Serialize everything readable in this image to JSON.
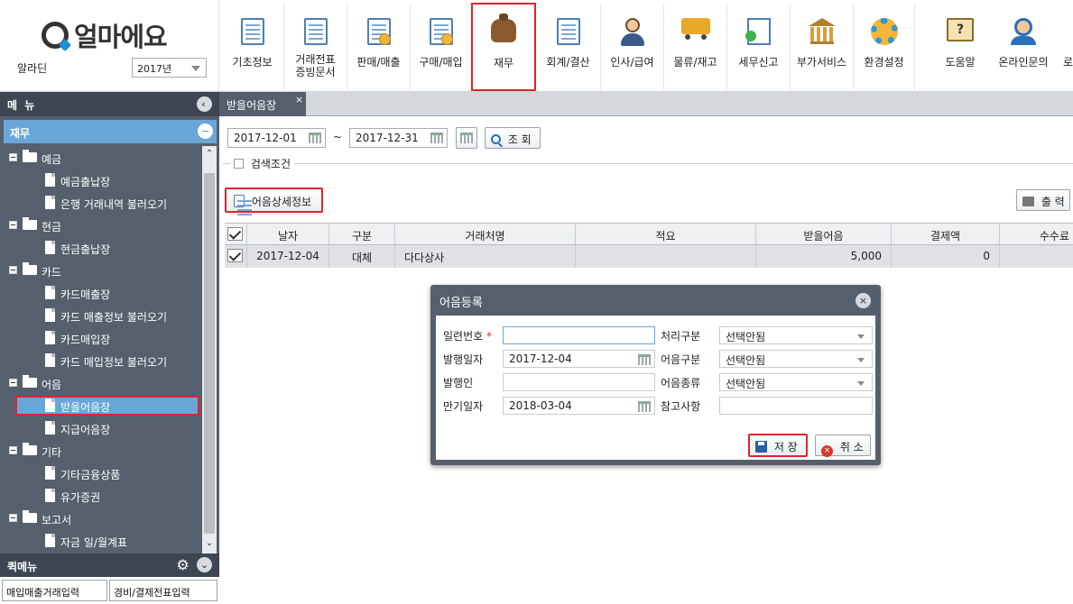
{
  "app": {
    "logo_text": "얼마에요",
    "company": "알라딘",
    "year": "2017년"
  },
  "top_menu": [
    {
      "id": "basic",
      "label": "기초정보"
    },
    {
      "id": "voucher",
      "label": "거래전표\n증빙문서"
    },
    {
      "id": "sales",
      "label": "판매/매출"
    },
    {
      "id": "purchase",
      "label": "구매/매입"
    },
    {
      "id": "finance",
      "label": "재무"
    },
    {
      "id": "accounting",
      "label": "회계/결산"
    },
    {
      "id": "hr",
      "label": "인사/급여"
    },
    {
      "id": "logistics",
      "label": "물류/재고"
    },
    {
      "id": "tax",
      "label": "세무신고"
    },
    {
      "id": "addon",
      "label": "부가서비스"
    },
    {
      "id": "settings",
      "label": "환경설정"
    },
    {
      "id": "help",
      "label": "도움말"
    },
    {
      "id": "online",
      "label": "온라인문의"
    },
    {
      "id": "logout",
      "label": "로"
    }
  ],
  "sidebar": {
    "menu_title": "메 뉴",
    "section_title": "재무",
    "tree": [
      {
        "type": "folder",
        "label": "예금"
      },
      {
        "type": "file",
        "label": "예금출납장"
      },
      {
        "type": "file",
        "label": "은행 거래내역 불러오기"
      },
      {
        "type": "folder",
        "label": "현금"
      },
      {
        "type": "file",
        "label": "현금출납장"
      },
      {
        "type": "folder",
        "label": "카드"
      },
      {
        "type": "file",
        "label": "카드매출장"
      },
      {
        "type": "file",
        "label": "카드 매출정보 불러오기"
      },
      {
        "type": "file",
        "label": "카드매입장"
      },
      {
        "type": "file",
        "label": "카드 매입정보 불러오기"
      },
      {
        "type": "folder",
        "label": "어음"
      },
      {
        "type": "file",
        "label": "받을어음장",
        "selected": true
      },
      {
        "type": "file",
        "label": "지급어음장"
      },
      {
        "type": "folder",
        "label": "기타"
      },
      {
        "type": "file",
        "label": "기타금융상품"
      },
      {
        "type": "file",
        "label": "유가증권"
      },
      {
        "type": "folder",
        "label": "보고서"
      },
      {
        "type": "file",
        "label": "자금 일/월계표"
      }
    ],
    "quick_title": "퀵메뉴",
    "quick_items": [
      "매입매출거래입력",
      "경비/결제전표입력"
    ]
  },
  "main": {
    "tab_label": "받을어음장",
    "tab_close": "×",
    "date_from": "2017-12-01",
    "date_sep": "~",
    "date_to": "2017-12-31",
    "search_label": "조 회",
    "search_condition_label": "검색조건",
    "detail_button": "어음상세정보",
    "print_button": "출 력",
    "grid": {
      "columns": [
        "날자",
        "구분",
        "거래처명",
        "적요",
        "받을어음",
        "결제액",
        "수수료"
      ],
      "rows": [
        [
          "2017-12-04",
          "대체",
          "다다상사",
          "",
          "5,000",
          "0",
          ""
        ]
      ]
    }
  },
  "dialog": {
    "title": "어음등록",
    "fields": {
      "serial_label": "일련번호",
      "serial_required": "*",
      "serial_value": "",
      "issue_date_label": "발행일자",
      "issue_date_value": "2017-12-04",
      "issuer_label": "발행인",
      "issuer_value": "",
      "due_date_label": "만기일자",
      "due_date_value": "2018-03-04",
      "process_label": "처리구분",
      "process_value": "선택안됨",
      "note_class_label": "어음구분",
      "note_class_value": "선택안됨",
      "note_type_label": "어음종류",
      "note_type_value": "선택안됨",
      "remark_label": "참고사항",
      "remark_value": ""
    },
    "save_label": "저 장",
    "cancel_label": "취 소"
  }
}
